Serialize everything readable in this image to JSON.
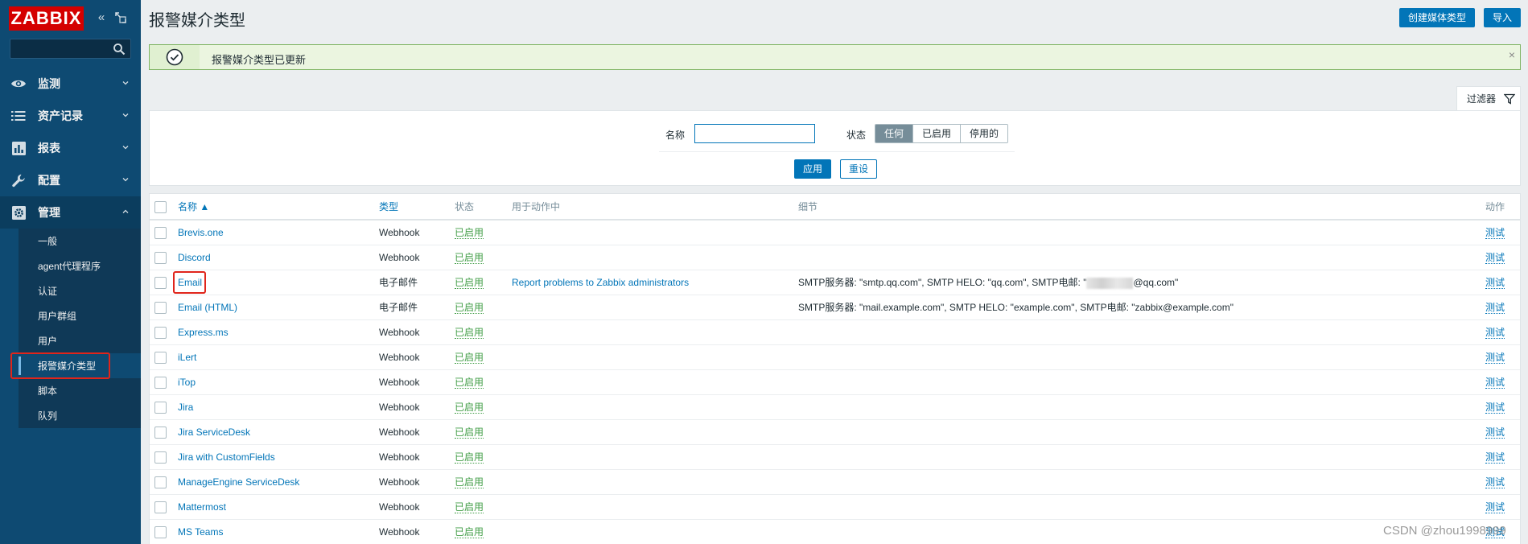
{
  "app": {
    "logo": "ZABBIX",
    "search_placeholder": ""
  },
  "sidebar": {
    "items": [
      {
        "label": "监测",
        "icon": "eye-icon"
      },
      {
        "label": "资产记录",
        "icon": "list-icon"
      },
      {
        "label": "报表",
        "icon": "bar-chart-icon"
      },
      {
        "label": "配置",
        "icon": "wrench-icon"
      },
      {
        "label": "管理",
        "icon": "gear-icon",
        "open": true
      }
    ],
    "submenu": [
      {
        "label": "一般"
      },
      {
        "label": "agent代理程序"
      },
      {
        "label": "认证"
      },
      {
        "label": "用户群组"
      },
      {
        "label": "用户"
      },
      {
        "label": "报警媒介类型",
        "active": true
      },
      {
        "label": "脚本"
      },
      {
        "label": "队列"
      }
    ]
  },
  "header": {
    "title": "报警媒介类型",
    "create_button": "创建媒体类型",
    "import_button": "导入"
  },
  "message": {
    "text": "报警媒介类型已更新",
    "close": "×"
  },
  "filter": {
    "tab_label": "过滤器",
    "name_label": "名称",
    "name_value": "",
    "status_label": "状态",
    "status_options": [
      "任何",
      "已启用",
      "停用的"
    ],
    "status_selected": 0,
    "apply_button": "应用",
    "reset_button": "重设"
  },
  "table": {
    "headers": {
      "name": "名称 ▲",
      "type": "类型",
      "status": "状态",
      "used_in": "用于动作中",
      "details": "细节",
      "actions": "动作"
    },
    "rows": [
      {
        "name": "Brevis.one",
        "type": "Webhook",
        "status": "已启用",
        "used_in": "",
        "details": "",
        "action": "测试"
      },
      {
        "name": "Discord",
        "type": "Webhook",
        "status": "已启用",
        "used_in": "",
        "details": "",
        "action": "测试"
      },
      {
        "name": "Email",
        "type": "电子邮件",
        "status": "已启用",
        "used_in": "Report problems to Zabbix administrators",
        "details_pre": "SMTP服务器: \"smtp.qq.com\", SMTP HELO: \"qq.com\", SMTP电邮: \"",
        "details_post": "@qq.com\"",
        "redacted": true,
        "action": "测试"
      },
      {
        "name": "Email (HTML)",
        "type": "电子邮件",
        "status": "已启用",
        "used_in": "",
        "details": "SMTP服务器: \"mail.example.com\", SMTP HELO: \"example.com\", SMTP电邮: \"zabbix@example.com\"",
        "action": "测试"
      },
      {
        "name": "Express.ms",
        "type": "Webhook",
        "status": "已启用",
        "used_in": "",
        "details": "",
        "action": "测试"
      },
      {
        "name": "iLert",
        "type": "Webhook",
        "status": "已启用",
        "used_in": "",
        "details": "",
        "action": "测试"
      },
      {
        "name": "iTop",
        "type": "Webhook",
        "status": "已启用",
        "used_in": "",
        "details": "",
        "action": "测试"
      },
      {
        "name": "Jira",
        "type": "Webhook",
        "status": "已启用",
        "used_in": "",
        "details": "",
        "action": "测试"
      },
      {
        "name": "Jira ServiceDesk",
        "type": "Webhook",
        "status": "已启用",
        "used_in": "",
        "details": "",
        "action": "测试"
      },
      {
        "name": "Jira with CustomFields",
        "type": "Webhook",
        "status": "已启用",
        "used_in": "",
        "details": "",
        "action": "测试"
      },
      {
        "name": "ManageEngine ServiceDesk",
        "type": "Webhook",
        "status": "已启用",
        "used_in": "",
        "details": "",
        "action": "测试"
      },
      {
        "name": "Mattermost",
        "type": "Webhook",
        "status": "已启用",
        "used_in": "",
        "details": "",
        "action": "测试"
      },
      {
        "name": "MS Teams",
        "type": "Webhook",
        "status": "已启用",
        "used_in": "",
        "details": "",
        "action": "测试"
      }
    ]
  },
  "watermark": "CSDN @zhou1998999",
  "colors": {
    "sidebar": "#0e4a72",
    "accent": "#0275b8",
    "enabled": "#429e47",
    "highlight": "#e0251b"
  }
}
